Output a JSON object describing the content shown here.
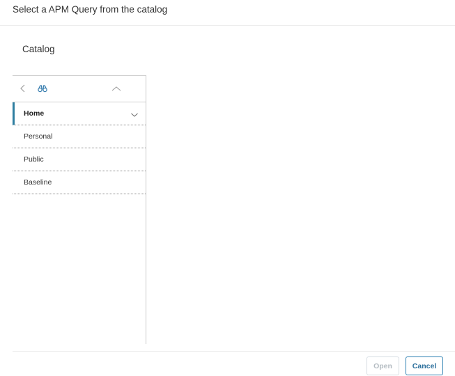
{
  "dialog": {
    "title": "Select a APM Query from the catalog"
  },
  "catalog": {
    "section_title": "Catalog",
    "toolbar": {
      "back_icon": "chevron-left-icon",
      "find_icon": "binoculars-icon",
      "up_icon": "chevron-up-icon"
    },
    "items": [
      {
        "label": "Home",
        "selected": true,
        "expand_icon": "chevron-down-icon"
      },
      {
        "label": "Personal",
        "selected": false
      },
      {
        "label": "Public",
        "selected": false
      },
      {
        "label": "Baseline",
        "selected": false
      }
    ]
  },
  "footer": {
    "open_label": "Open",
    "open_enabled": false,
    "cancel_label": "Cancel"
  },
  "colors": {
    "accent": "#2d7ea0",
    "button_primary_border": "#2b7fb1",
    "disabled_text": "#b4bcc2"
  }
}
